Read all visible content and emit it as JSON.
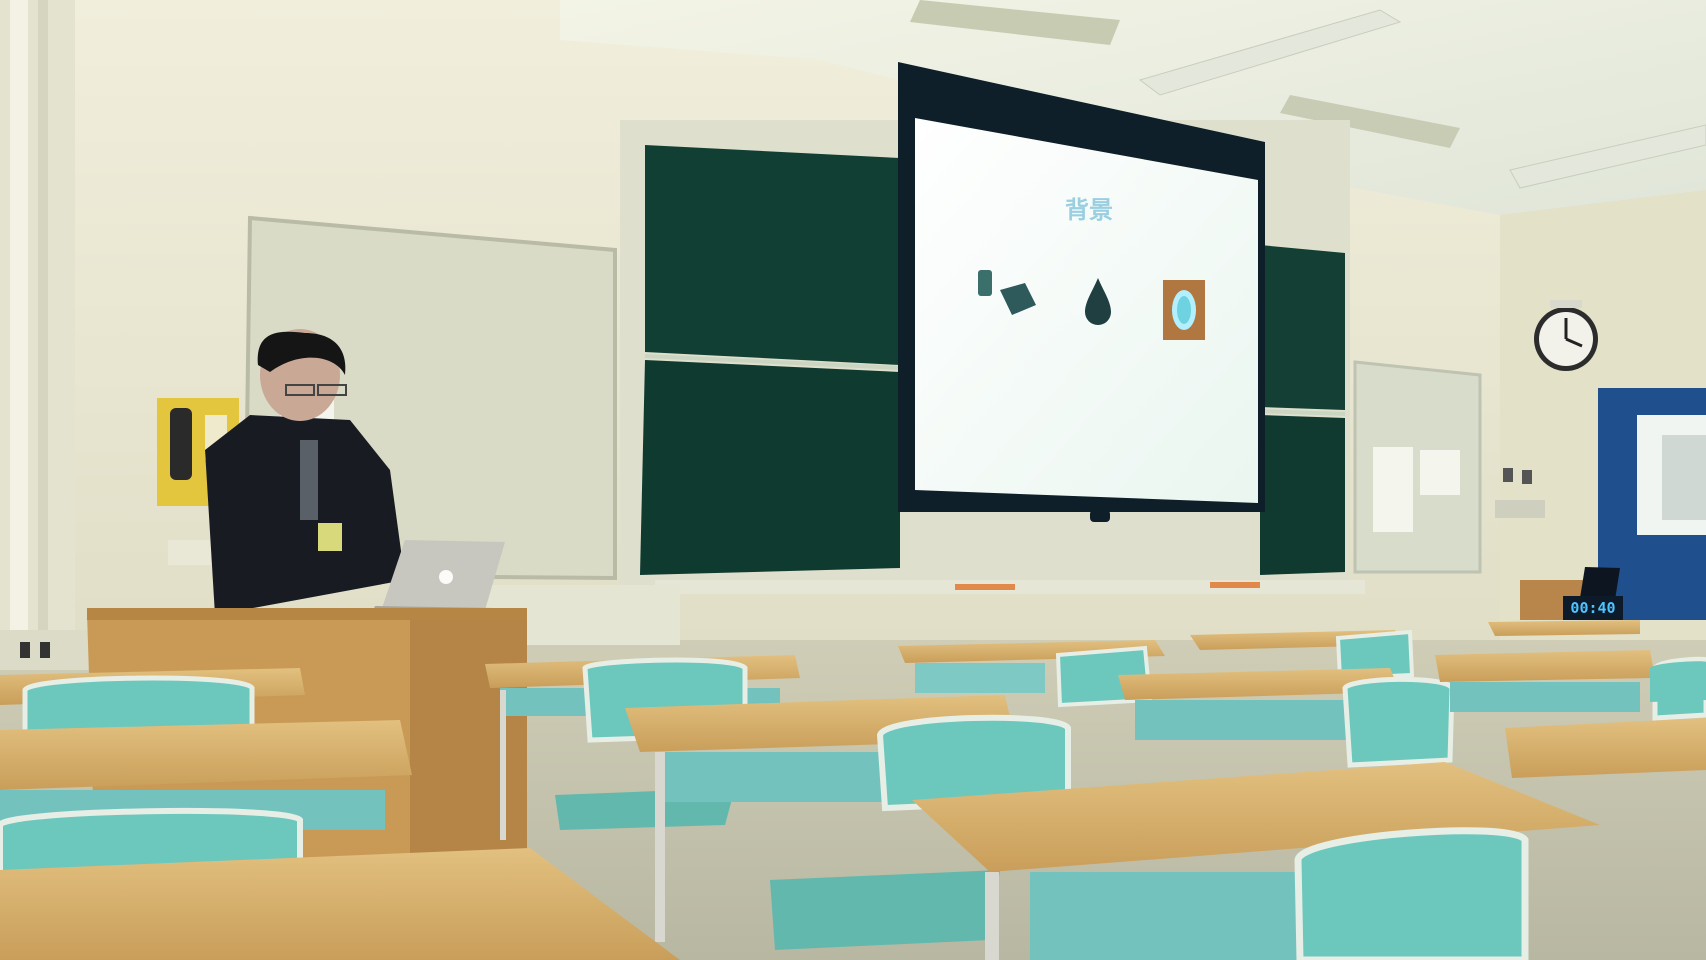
{
  "scene": {
    "description_free": true,
    "colors": {
      "wall": "#e9e6cf",
      "ceiling": "#eef0df",
      "chalkboard": "#123f33",
      "desk_top": "#d9b572",
      "chair": "#6cc7bd",
      "podium": "#c99a55",
      "screen": "#f4fbf6",
      "door": "#1f4f8c"
    }
  },
  "slide": {
    "title": "背景"
  },
  "timer": {
    "display": "00:40"
  },
  "icons": {
    "clock": "wall-clock-icon",
    "laptop_logo": "apple-logo-icon",
    "drop": "water-drop-icon"
  }
}
